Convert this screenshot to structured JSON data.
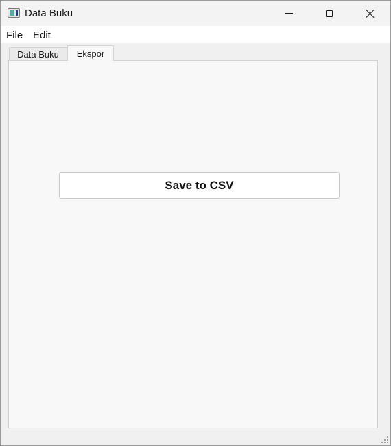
{
  "window": {
    "title": "Data Buku"
  },
  "menu": {
    "items": [
      {
        "label": "File"
      },
      {
        "label": "Edit"
      }
    ]
  },
  "tabs": [
    {
      "label": "Data Buku",
      "active": false
    },
    {
      "label": "Ekspor",
      "active": true
    }
  ],
  "export_panel": {
    "save_button_label": "Save to CSV"
  },
  "icons": {
    "app": "app-window-icon",
    "minimize": "minimize-icon",
    "maximize": "maximize-icon",
    "close": "close-icon",
    "resize": "size-grip-icon"
  }
}
